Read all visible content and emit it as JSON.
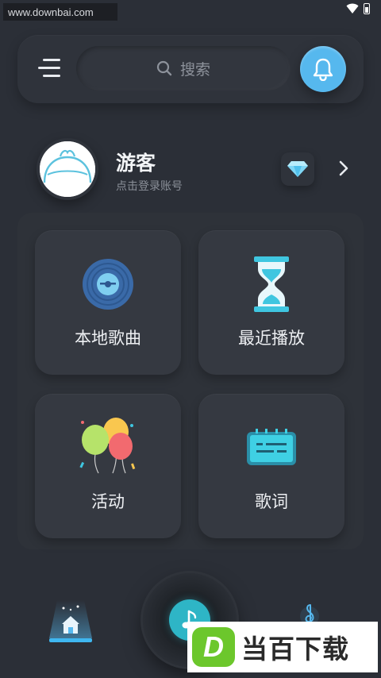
{
  "watermark": {
    "site": "www.downbai.com",
    "brand_letter": "D",
    "brand_name": "当百下载"
  },
  "search": {
    "placeholder": "搜索"
  },
  "user": {
    "name": "游客",
    "subtitle": "点击登录账号"
  },
  "features": [
    {
      "label": "本地歌曲",
      "icon": "vinyl-record-icon"
    },
    {
      "label": "最近播放",
      "icon": "hourglass-icon"
    },
    {
      "label": "活动",
      "icon": "balloons-icon"
    },
    {
      "label": "歌词",
      "icon": "lyrics-card-icon"
    }
  ],
  "bottom_nav": {
    "items": [
      {
        "icon": "home-icon",
        "active": true
      },
      {
        "icon": "music-note-disc-icon"
      },
      {
        "icon": "treble-clef-icon"
      }
    ]
  },
  "colors": {
    "background": "#2b2f37",
    "accent": "#56b8ee",
    "play": "#2eb5c6",
    "brand_green": "#6cc72c"
  }
}
